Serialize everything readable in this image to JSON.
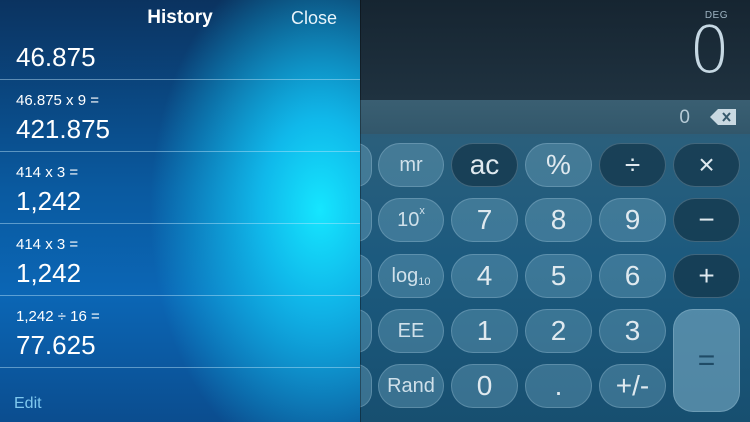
{
  "history": {
    "title": "History",
    "close_label": "Close",
    "edit_label": "Edit",
    "items": [
      {
        "expression": "",
        "result": "46.875"
      },
      {
        "expression": "46.875 x 9 =",
        "result": "421.875"
      },
      {
        "expression": "414 x 3 =",
        "result": "1,242"
      },
      {
        "expression": "414 x 3 =",
        "result": "1,242"
      },
      {
        "expression": "1,242 ÷ 16 =",
        "result": "77.625"
      }
    ]
  },
  "calculator": {
    "angle_mode": "DEG",
    "display": "0",
    "memory_value": "0",
    "keys": {
      "mr": "mr",
      "ac": "ac",
      "percent": "%",
      "divide": "÷",
      "multiply": "×",
      "ten_pow_base": "10",
      "ten_pow_exp": "x",
      "seven": "7",
      "eight": "8",
      "nine": "9",
      "minus": "−",
      "log_base": "log",
      "log_sub": "10",
      "four": "4",
      "five": "5",
      "six": "6",
      "plus": "+",
      "ee": "EE",
      "one": "1",
      "two": "2",
      "three": "3",
      "rand": "Rand",
      "zero": "0",
      "decimal": ".",
      "plus_minus": "+/-",
      "equals": "="
    }
  },
  "colors": {
    "history_glow": "#15e6ff",
    "history_base": "#0a5aa0",
    "edit_link": "#7fc8ee",
    "calc_background": "#1c5a7e"
  }
}
